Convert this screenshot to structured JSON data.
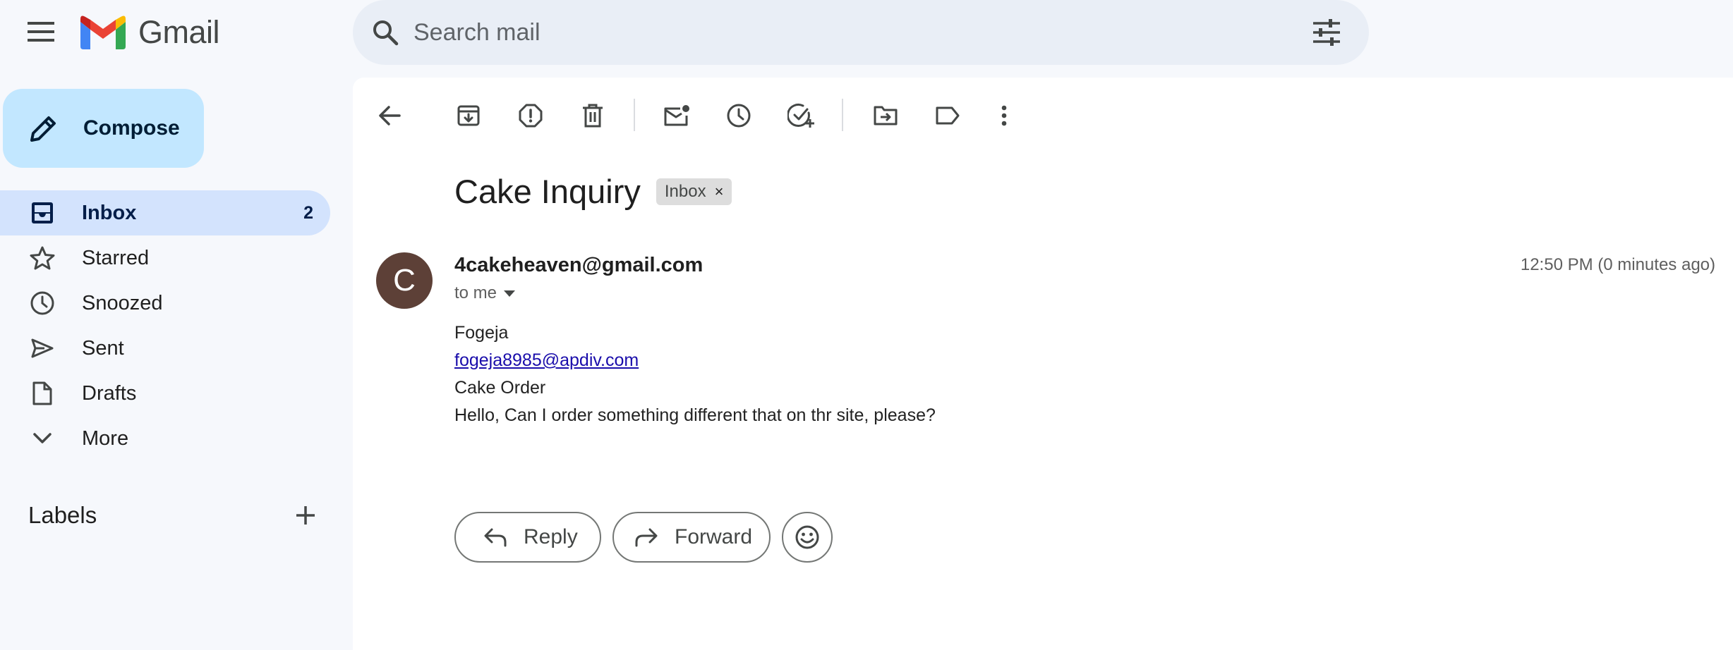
{
  "header": {
    "app_name": "Gmail",
    "search_placeholder": "Search mail"
  },
  "sidebar": {
    "compose_label": "Compose",
    "items": [
      {
        "label": "Inbox",
        "count": "2",
        "icon": "inbox-icon",
        "active": true
      },
      {
        "label": "Starred",
        "icon": "star-icon"
      },
      {
        "label": "Snoozed",
        "icon": "clock-icon"
      },
      {
        "label": "Sent",
        "icon": "send-icon"
      },
      {
        "label": "Drafts",
        "icon": "draft-icon"
      },
      {
        "label": "More",
        "icon": "chevron-down-icon"
      }
    ],
    "labels_title": "Labels"
  },
  "toolbar": {
    "icons": [
      "back-icon",
      "archive-icon",
      "report-spam-icon",
      "delete-icon",
      "mark-unread-icon",
      "snooze-icon",
      "add-task-icon",
      "move-to-icon",
      "label-icon",
      "more-options-icon"
    ]
  },
  "email": {
    "subject": "Cake Inquiry",
    "label_chip": "Inbox",
    "chip_close": "×",
    "avatar_letter": "C",
    "sender": "4cakeheaven@gmail.com",
    "recipient": "to me",
    "time": "12:50 PM (0 minutes ago)",
    "body": {
      "name": "Fogeja",
      "email": "fogeja8985@apdiv.com",
      "subject_line": "Cake Order",
      "message": "Hello, Can I order something different that on thr site, please?"
    }
  },
  "actions": {
    "reply_label": "Reply",
    "forward_label": "Forward"
  },
  "colors": {
    "page_bg": "#f6f8fc",
    "compose_bg": "#c2e7ff",
    "active_nav_bg": "#d3e3fd",
    "avatar_bg": "#5d4037",
    "link": "#1a0dab"
  }
}
